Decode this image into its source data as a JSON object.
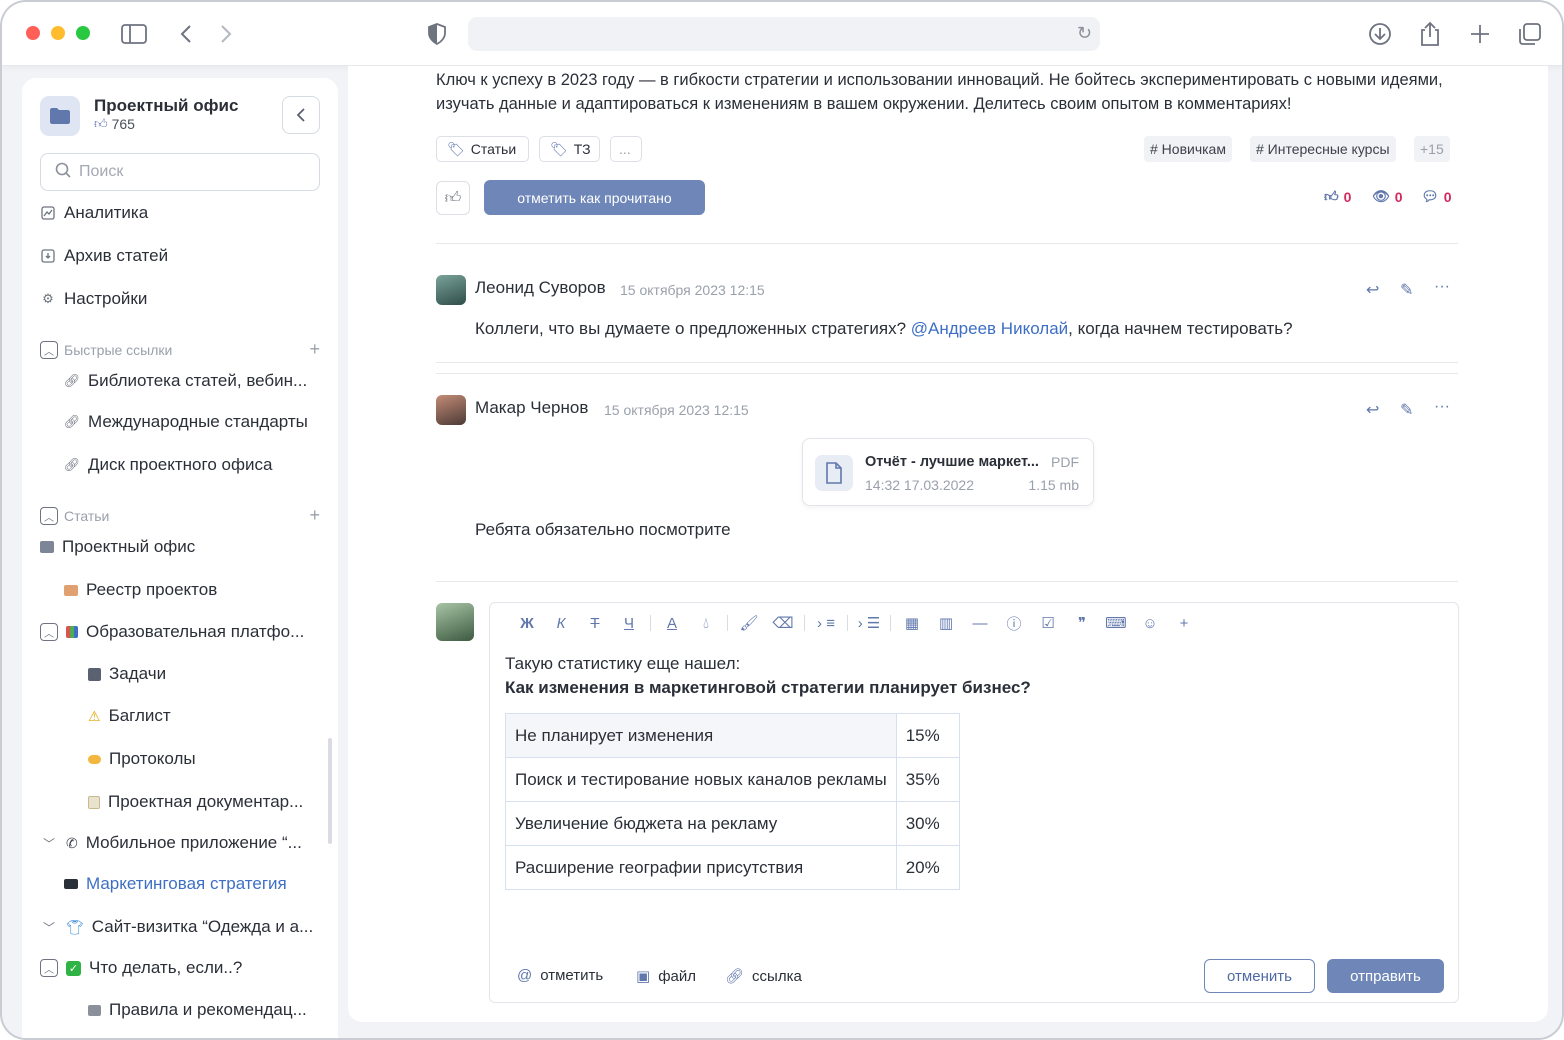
{
  "browser": {
    "icons": [
      "sidebar-toggle-icon",
      "back-icon",
      "forward-icon",
      "shield-icon",
      "reload-icon",
      "download-icon",
      "share-icon",
      "new-tab-icon",
      "tabs-overview-icon"
    ]
  },
  "sidebar": {
    "workspace_title": "Проектный офис",
    "workspace_likes": "765",
    "search_placeholder": "Поиск",
    "top_items": [
      {
        "label": "Аналитика",
        "icon": "chart-icon"
      },
      {
        "label": "Архив статей",
        "icon": "archive-icon"
      },
      {
        "label": "Настройки",
        "icon": "gear-icon"
      }
    ],
    "quick_links_header": "Быстрые ссылки",
    "quick_links": [
      {
        "label": "Библиотека статей, вебин..."
      },
      {
        "label": "Международные стандарты"
      },
      {
        "label": "Диск проектного офиса"
      }
    ],
    "articles_header": "Статьи",
    "tree": [
      {
        "label": "Проектный офис",
        "emoji": "office-building-icon"
      },
      {
        "label": "Реестр проектов",
        "emoji": "card-box-icon"
      },
      {
        "label": "Образовательная платфо...",
        "emoji": "books-icon"
      },
      {
        "label": "Задачи",
        "emoji": "floppy-disk-icon"
      },
      {
        "label": "Баглист",
        "emoji": "warning-icon"
      },
      {
        "label": "Протоколы",
        "emoji": "handshake-icon"
      },
      {
        "label": "Проектная документар...",
        "emoji": "memo-icon"
      },
      {
        "label": "Мобильное приложение “...",
        "emoji": "phone-icon"
      },
      {
        "label": "Маркетинговая стратегия",
        "emoji": "computer-icon"
      },
      {
        "label": "Сайт-визитка “Одежда и а...",
        "emoji": "tshirt-icon"
      },
      {
        "label": "Что делать, если..?",
        "emoji": "check-mark-icon"
      },
      {
        "label": "Правила и рекомендац...",
        "emoji": "folder-icon"
      }
    ]
  },
  "post": {
    "intro_text": "Ключ к успеху в 2023 году — в гибкости стратегии и использовании инноваций. Не бойтесь экспериментировать с новыми идеями, изучать данные и адаптироваться к изменениям в вашем окружении. Делитесь своим опытом в комментариях!",
    "tags": [
      "Статьи",
      "ТЗ",
      "..."
    ],
    "hashtags": [
      "# Новичкам",
      "# Интересные курсы",
      "+15"
    ],
    "mark_read_label": "отметить как прочитано",
    "likes": "0",
    "views": "0",
    "comments": "0"
  },
  "comments": [
    {
      "author": "Леонид Суворов",
      "time": "15 октября 2023 12:15",
      "text_before": "Коллеги, что вы думаете о предложенных стратегиях? ",
      "mention": "@Андреев Николай",
      "text_after": ", когда начнем тестировать?"
    },
    {
      "author": "Макар Чернов",
      "time": "15 октября 2023 12:15",
      "attachment": {
        "name": "Отчёт - лучшие маркет...",
        "type": "PDF",
        "date": "14:32 17.03.2022",
        "size": "1.15 mb"
      },
      "text": "Ребята обязательно посмотрите"
    }
  ],
  "editor": {
    "toolbar": [
      "Ж",
      "К",
      "Т",
      "Ч",
      "А",
      "◌",
      "format-painter",
      "eraser",
      "align",
      "list",
      "table",
      "columns",
      "divider",
      "info",
      "checkbox",
      "quote",
      "code",
      "emoji",
      "+"
    ],
    "line1": "Такую статистику еще нашел:",
    "line2": "Как изменения в маркетинговой стратегии планирует бизнес?",
    "table": [
      {
        "label": "Не планирует изменения",
        "value": "15%"
      },
      {
        "label": "Поиск и тестирование новых каналов рекламы",
        "value": "35%"
      },
      {
        "label": "Увеличение бюджета на рекламу",
        "value": "30%"
      },
      {
        "label": "Расширение географии присутствия",
        "value": "20%"
      }
    ],
    "mention_label": "отметить",
    "file_label": "файл",
    "link_label": "ссылка",
    "cancel_label": "отменить",
    "send_label": "отправить"
  },
  "colors": {
    "accent": "#6e86b8",
    "link": "#3e6fc5",
    "counter": "#d4285e"
  }
}
